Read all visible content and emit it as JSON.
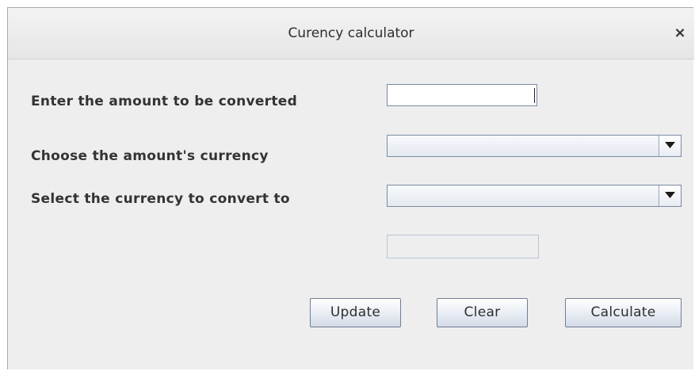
{
  "window": {
    "title": "Curency calculator",
    "close_symbol": "×"
  },
  "form": {
    "amount_label": "Enter the amount to be converted",
    "amount_value": "",
    "from_currency_label": "Choose the amount's currency",
    "from_currency_selected": "",
    "to_currency_label": "Select the currency to convert to",
    "to_currency_selected": "",
    "result_value": ""
  },
  "buttons": {
    "update": "Update",
    "clear": "Clear",
    "calculate": "Calculate"
  },
  "icons": {
    "close": "close-icon",
    "dropdown": "triangle-down-icon"
  }
}
